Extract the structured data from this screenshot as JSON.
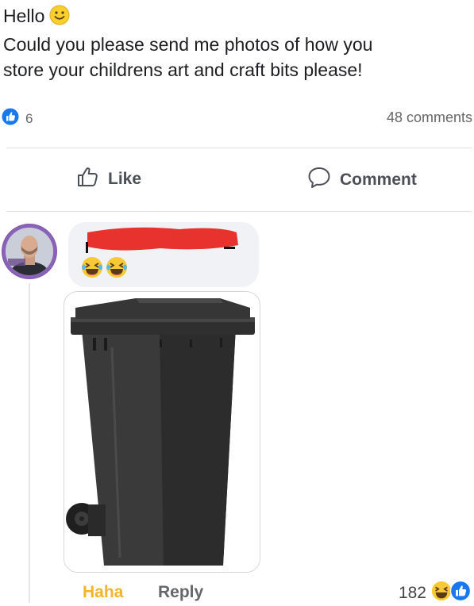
{
  "post": {
    "greeting": "Hello",
    "line1": "Could you please send me photos of how you",
    "line2": "store your childrens art and craft bits please!",
    "like_count": "6",
    "comments_count": "48 comments"
  },
  "actions": {
    "like_label": "Like",
    "comment_label": "Comment"
  },
  "comment": {
    "reply_label": "Reply",
    "reaction_label": "Haha",
    "reaction_count": "182"
  },
  "colors": {
    "facebook_blue": "#1877f2",
    "haha_yellow": "#f2b52a",
    "redaction_red": "#e8322e"
  },
  "icons": [
    "smiley-emoji-icon",
    "like-thumb-icon",
    "comment-bubble-icon",
    "laughing-emoji-icon",
    "like-reaction-icon"
  ]
}
